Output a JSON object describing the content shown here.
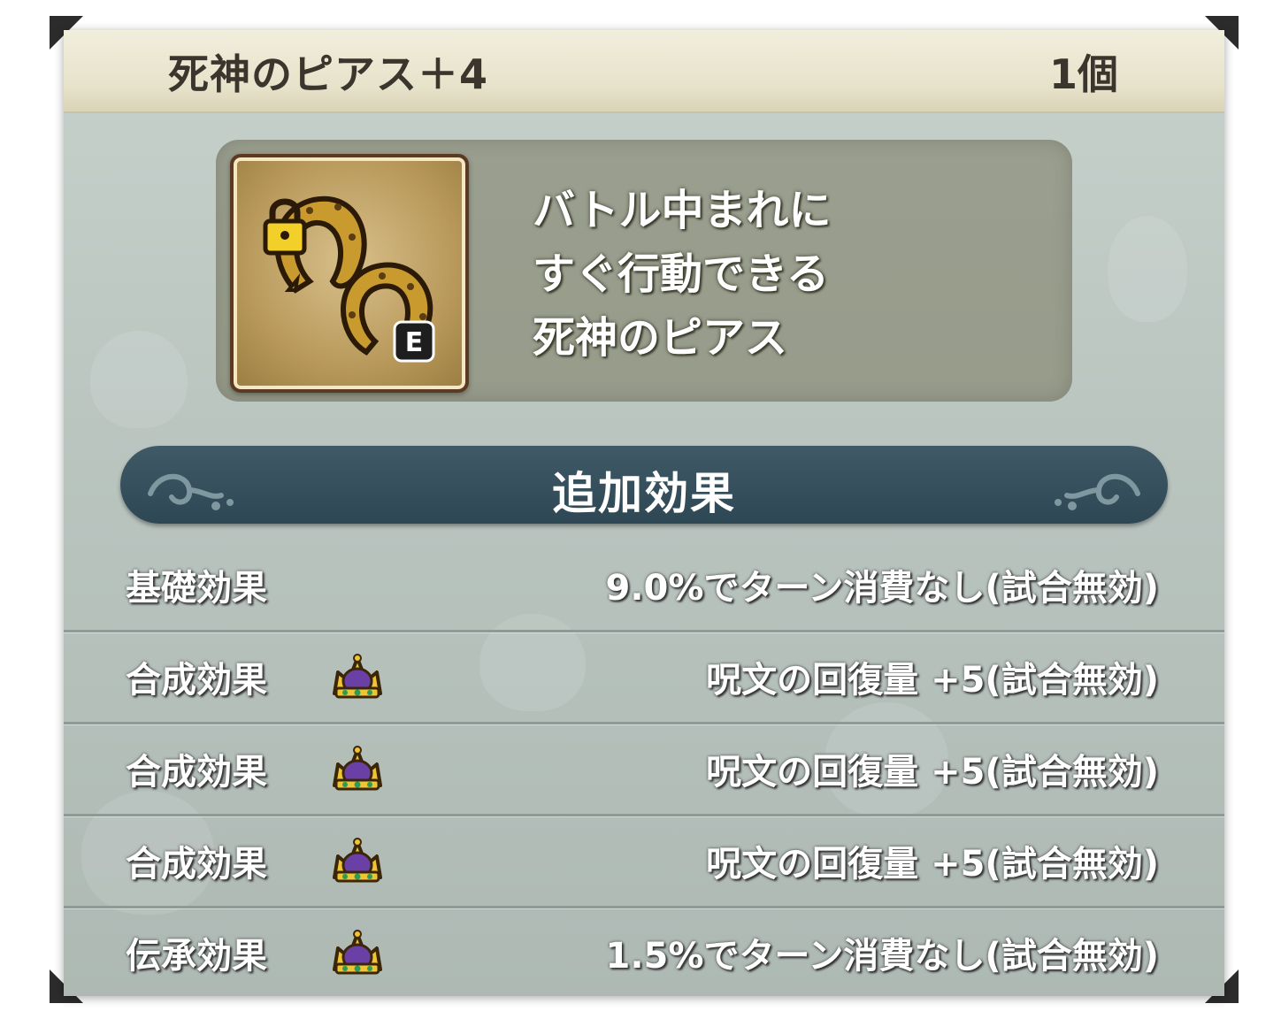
{
  "item": {
    "name": "死神のピアス＋4",
    "quantity": "1個",
    "badge": "E",
    "description": [
      "バトル中まれに",
      "すぐ行動できる",
      "死神のピアス"
    ]
  },
  "section": {
    "title": "追加効果"
  },
  "effects": [
    {
      "label": "基礎効果",
      "icon": null,
      "value": "9.0%でターン消費なし(試合無効)"
    },
    {
      "label": "合成効果",
      "icon": "crown-icon",
      "value": "呪文の回復量 +5(試合無効)"
    },
    {
      "label": "合成効果",
      "icon": "crown-icon",
      "value": "呪文の回復量 +5(試合無効)"
    },
    {
      "label": "合成効果",
      "icon": "crown-icon",
      "value": "呪文の回復量 +5(試合無効)"
    },
    {
      "label": "伝承効果",
      "icon": "crown-icon",
      "value": "1.5%でターン消費なし(試合無効)"
    }
  ],
  "colors": {
    "title_bar": "#e7e2ca",
    "panel_background": "#b9c4bf",
    "section_header": "#2e4754",
    "icon_frame": "#5c3a22",
    "earring_gold": "#c99a2e"
  }
}
